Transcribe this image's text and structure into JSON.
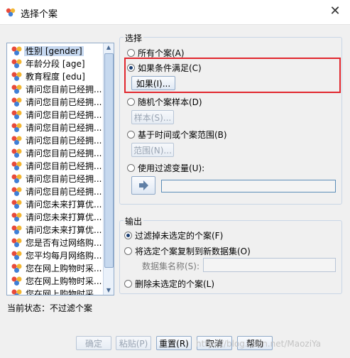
{
  "window": {
    "title": "选择个案",
    "close_label": "✕"
  },
  "variables": [
    {
      "label": "性别 [gender]",
      "selected": true
    },
    {
      "label": "年龄分段 [age]"
    },
    {
      "label": "教育程度 [edu]"
    },
    {
      "label": "请问您目前已经拥..."
    },
    {
      "label": "请问您目前已经拥..."
    },
    {
      "label": "请问您目前已经拥..."
    },
    {
      "label": "请问您目前已经拥..."
    },
    {
      "label": "请问您目前已经拥..."
    },
    {
      "label": "请问您目前已经拥..."
    },
    {
      "label": "请问您目前已经拥..."
    },
    {
      "label": "请问您目前已经拥..."
    },
    {
      "label": "请问您目前已经拥..."
    },
    {
      "label": "请问您未来打算优..."
    },
    {
      "label": "请问您未来打算优..."
    },
    {
      "label": "请问您未来打算优..."
    },
    {
      "label": "您是否有过网络购..."
    },
    {
      "label": "您平均每月网络购..."
    },
    {
      "label": "您在网上购物时采..."
    },
    {
      "label": "您在网上购物时采..."
    },
    {
      "label": "您在网上购物时采..."
    },
    {
      "label": "您在网上购物时采..."
    }
  ],
  "status": {
    "text": "当前状态：不过滤个案"
  },
  "select_group": {
    "title": "选择",
    "all_cases": "所有个案(A)",
    "if_condition": "如果条件满足(C)",
    "if_button": "如果(I)...",
    "random_sample": "随机个案样本(D)",
    "sample_button": "样本(S)...",
    "time_range": "基于时间或个案范围(B)",
    "range_button": "范围(N)...",
    "use_filter": "使用过滤变量(U):",
    "filter_value": ""
  },
  "output_group": {
    "title": "输出",
    "filter_out": "过滤掉未选定的个案(F)",
    "copy_to_new": "将选定个案复制到新数据集(O)",
    "dataset_name_label": "数据集名称(S):",
    "dataset_name_value": "",
    "delete_unselected": "删除未选定的个案(L)"
  },
  "footer": {
    "ok": "确定",
    "paste": "粘贴(P)",
    "reset": "重置(R)",
    "cancel": "取消",
    "help": "帮助",
    "watermark": "https://blog.csdn.net/MaoziYa"
  },
  "colors": {
    "highlight": "#e1262d",
    "selection": "#c6d8f0",
    "accent": "#1a3e73"
  }
}
